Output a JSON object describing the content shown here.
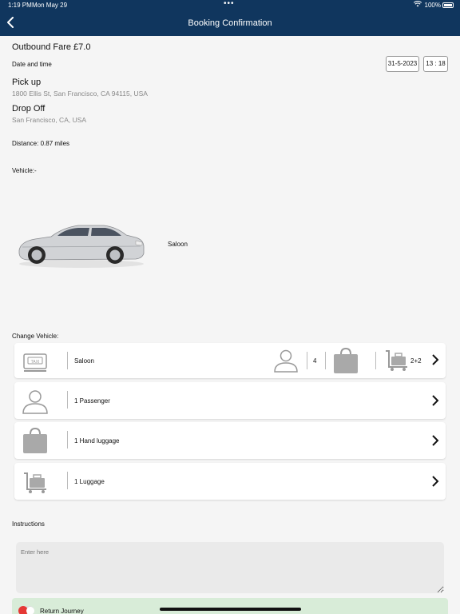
{
  "status_bar": {
    "time": "1:19 PM",
    "date": "Mon May 29",
    "battery": "100%"
  },
  "header": {
    "title": "Booking Confirmation"
  },
  "fare": {
    "label": "Outbound Fare £7.0"
  },
  "date_time": {
    "label": "Date and time",
    "date": "31-5-2023",
    "time": "13 : 18"
  },
  "pickup": {
    "title": "Pick up",
    "address": "1800 Ellis St, San Francisco, CA 94115, USA"
  },
  "dropoff": {
    "title": "Drop Off",
    "address": "San Francisco, CA, USA"
  },
  "distance": {
    "label": "Distance: 0.87 miles"
  },
  "vehicle": {
    "label": "Vehicle:-",
    "name": "Saloon"
  },
  "change_vehicle": {
    "label": "Change Vehicle:",
    "vehicle_row": {
      "name": "Saloon",
      "passengers": "4",
      "luggage": "2+2"
    },
    "passenger_row": "1 Passenger",
    "hand_luggage_row": "1 Hand luggage",
    "luggage_row": "1 Luggage"
  },
  "instructions": {
    "label": "Instructions",
    "placeholder": "Enter here"
  },
  "return_journey": {
    "label": "Return Journey"
  }
}
